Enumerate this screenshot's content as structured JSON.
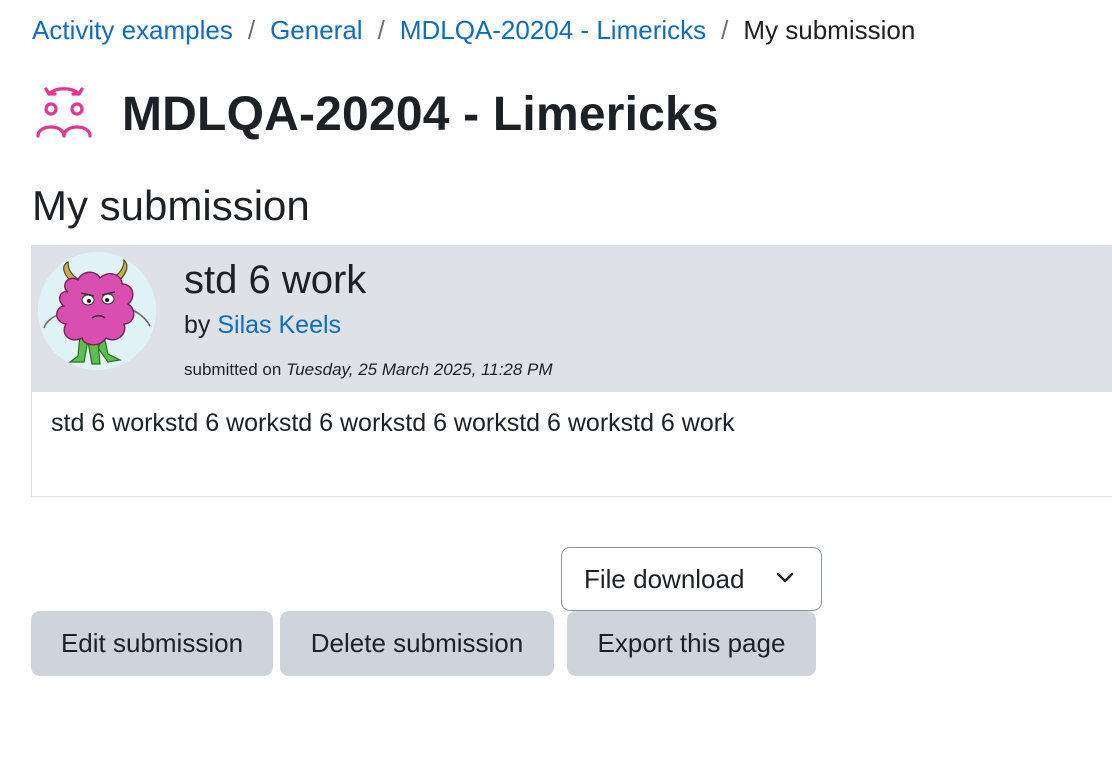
{
  "breadcrumb": {
    "items": [
      {
        "label": "Activity examples"
      },
      {
        "label": "General"
      },
      {
        "label": "MDLQA-20204 - Limericks"
      }
    ],
    "separator": "/",
    "current": "My submission"
  },
  "page": {
    "title": "MDLQA-20204 - Limericks",
    "icon": "workshop-peer-assessment-icon",
    "accent_color": "#e2368f"
  },
  "section": {
    "title": "My submission"
  },
  "submission": {
    "title": "std 6 work",
    "by_label": "by",
    "author": "Silas Keels",
    "avatar_icon": "pink-monster-avatar",
    "submitted_label": "submitted on",
    "submitted_date": "Tuesday, 25 March 2025, 11:28 PM",
    "content": "std 6 workstd 6 workstd 6 workstd 6 workstd 6 workstd 6 work"
  },
  "actions": {
    "download_select_value": "File download",
    "edit_label": "Edit submission",
    "delete_label": "Delete submission",
    "export_label": "Export this page"
  },
  "colors": {
    "link": "#0f6cbf",
    "header_bg": "#dee2e6",
    "button_bg": "#ced4da",
    "text": "#1d2125"
  }
}
